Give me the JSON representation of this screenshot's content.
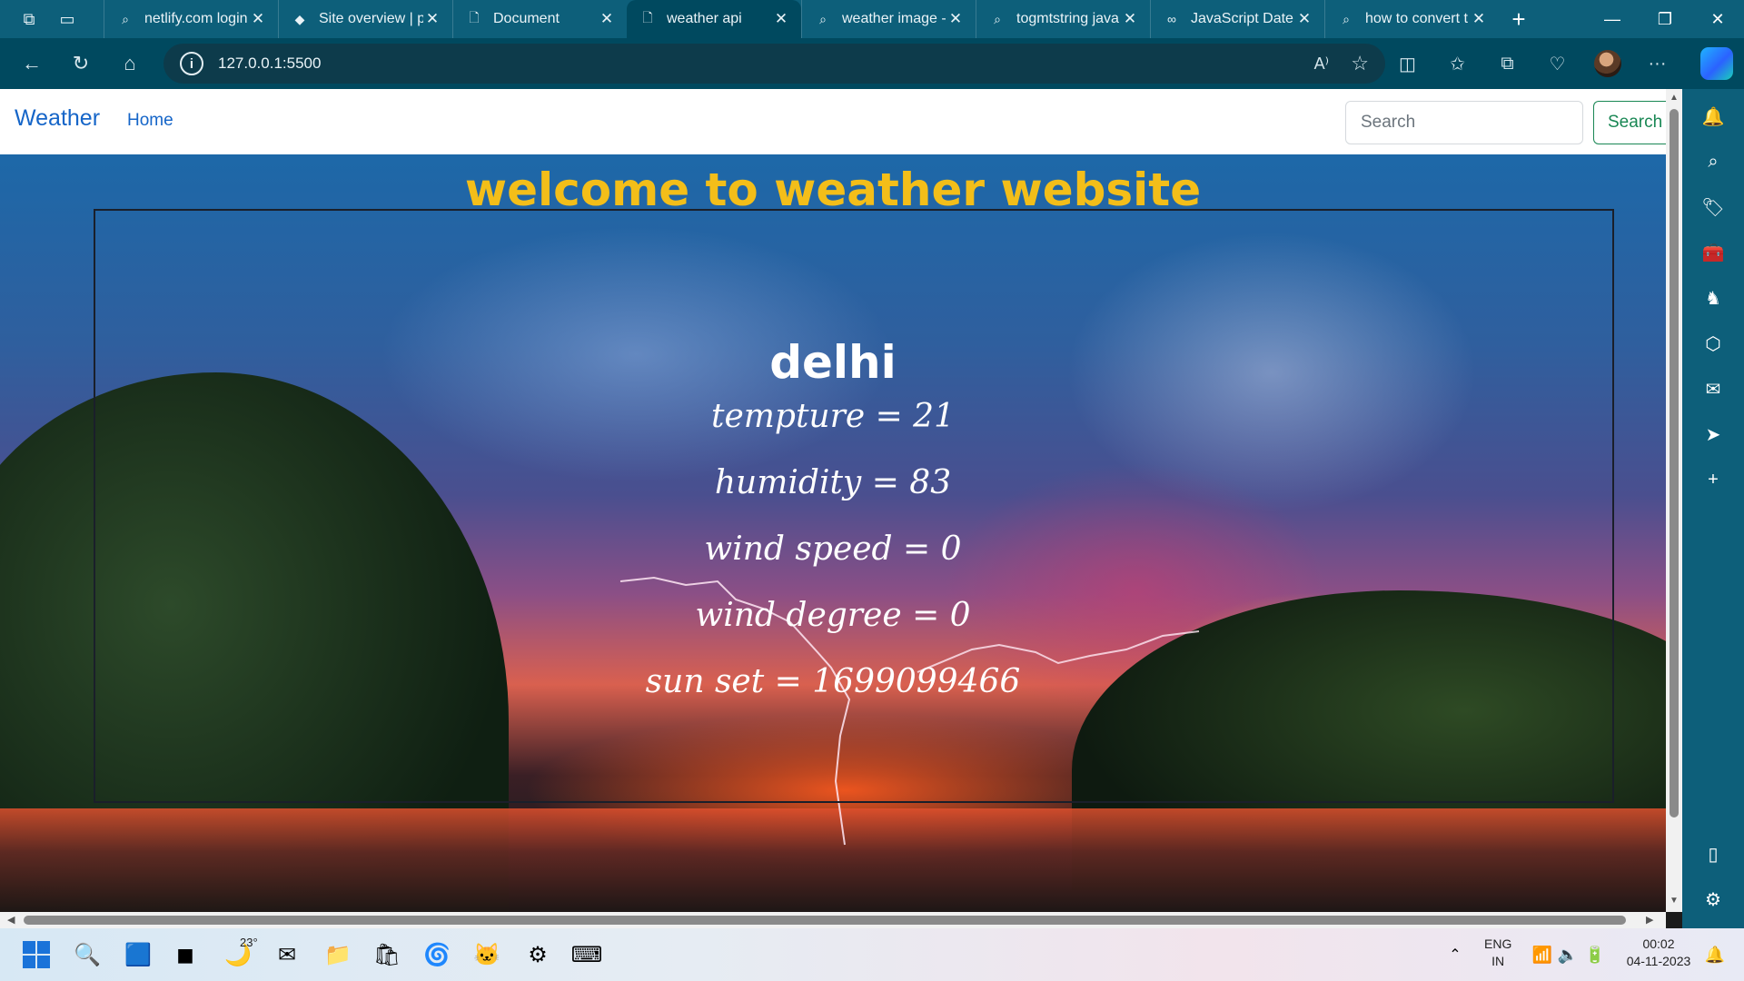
{
  "browser": {
    "tabs": [
      {
        "label": "netlify.com login",
        "favicon": "search-icon",
        "active": false
      },
      {
        "label": "Site overview | p",
        "favicon": "netlify-icon",
        "active": false
      },
      {
        "label": "Document",
        "favicon": "document-icon",
        "active": false
      },
      {
        "label": "weather api",
        "favicon": "document-icon",
        "active": true
      },
      {
        "label": "weather image -",
        "favicon": "search-icon",
        "active": false
      },
      {
        "label": "togmtstring java",
        "favicon": "search-icon",
        "active": false
      },
      {
        "label": "JavaScript Date t",
        "favicon": "w3-icon",
        "active": false
      },
      {
        "label": "how to convert t",
        "favicon": "search-icon",
        "active": false
      }
    ],
    "url": "127.0.0.1:5500",
    "read_aloud_label": "A⁾"
  },
  "site": {
    "brand": "Weather",
    "nav_home": "Home",
    "search_placeholder": "Search",
    "search_button": "Search",
    "heading": "welcome to weather website",
    "city": "delhi",
    "stats": {
      "temperature": "tempture = 21",
      "humidity": "humidity = 83",
      "wind_speed": "wind speed = 0",
      "wind_degree": "wind degree = 0",
      "sunset": "sun set = 1699099466"
    }
  },
  "taskbar": {
    "weather_temp": "23°",
    "lang_top": "ENG",
    "lang_bottom": "IN",
    "time": "00:02",
    "date": "04-11-2023"
  },
  "colors": {
    "heading": "#f3be19",
    "brand_link": "#1565c8",
    "search_button": "#198754",
    "browser_chrome": "#00495f"
  }
}
